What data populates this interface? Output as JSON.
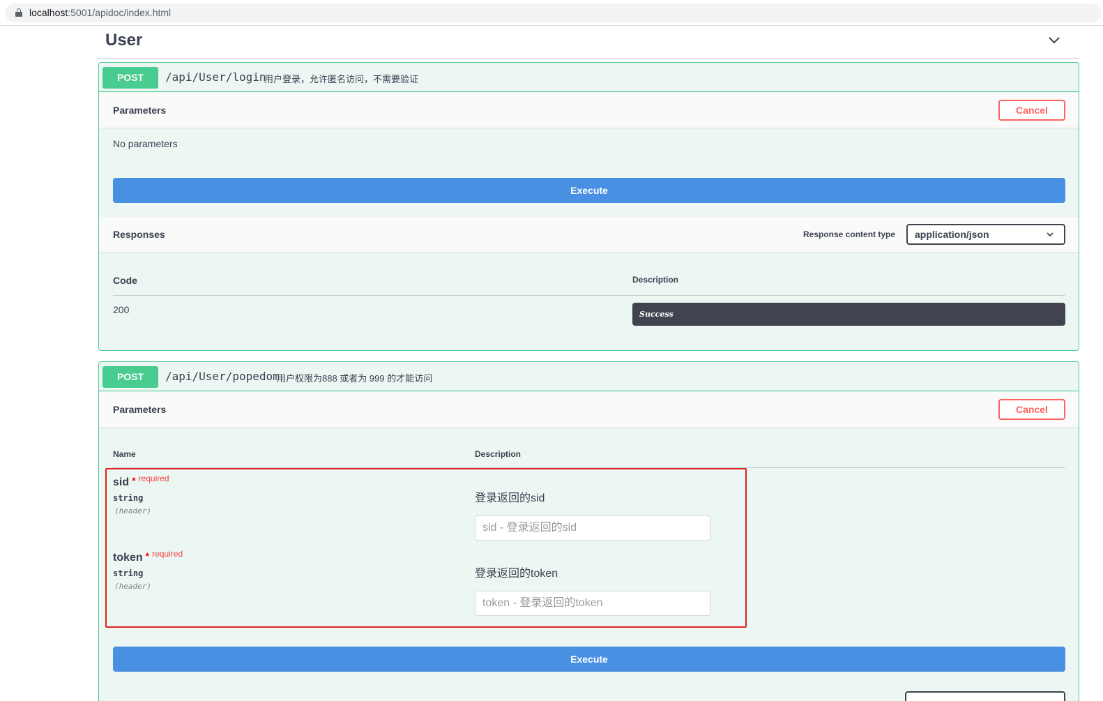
{
  "browser": {
    "url_host": "localhost",
    "url_rest": ":5001/apidoc/index.html"
  },
  "section": {
    "title": "User"
  },
  "ops": [
    {
      "method": "POST",
      "path": "/api/User/login",
      "summary": "用户登录，允许匿名访问，不需要验证",
      "parameters_title": "Parameters",
      "cancel_label": "Cancel",
      "no_params": "No parameters",
      "execute_label": "Execute",
      "responses_title": "Responses",
      "response_content_type_label": "Response content type",
      "response_content_type_value": "application/json",
      "col_code": "Code",
      "col_description": "Description",
      "response_code": "200",
      "response_desc": "Success"
    },
    {
      "method": "POST",
      "path": "/api/User/popedom",
      "summary": "用户权限为888 或者为 999 的才能访问",
      "parameters_title": "Parameters",
      "cancel_label": "Cancel",
      "col_name": "Name",
      "col_description": "Description",
      "params": [
        {
          "name": "sid",
          "star": "*",
          "required": "required",
          "type": "string",
          "in": "(header)",
          "description": "登录返回的sid",
          "placeholder": "sid - 登录返回的sid"
        },
        {
          "name": "token",
          "star": "*",
          "required": "required",
          "type": "string",
          "in": "(header)",
          "description": "登录返回的token",
          "placeholder": "token - 登录返回的token"
        }
      ],
      "execute_label": "Execute"
    }
  ],
  "colors": {
    "post": "#49cc90",
    "execute": "#4990e2",
    "cancel": "#ff6060",
    "highlight_box": "#e02020"
  }
}
